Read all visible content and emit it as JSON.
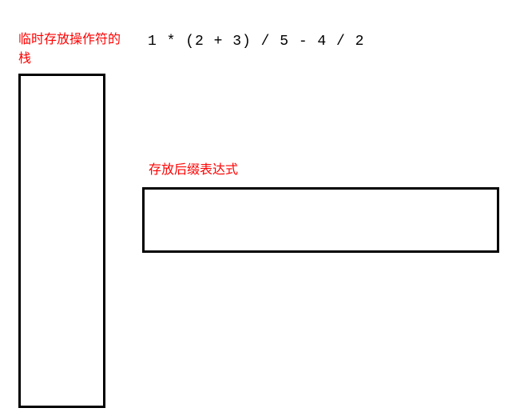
{
  "labels": {
    "stack": "临时存放操作符的栈",
    "output": "存放后缀表达式"
  },
  "expression": "1 * (2 + 3) / 5 - 4 / 2",
  "stack_contents": [],
  "output_contents": ""
}
